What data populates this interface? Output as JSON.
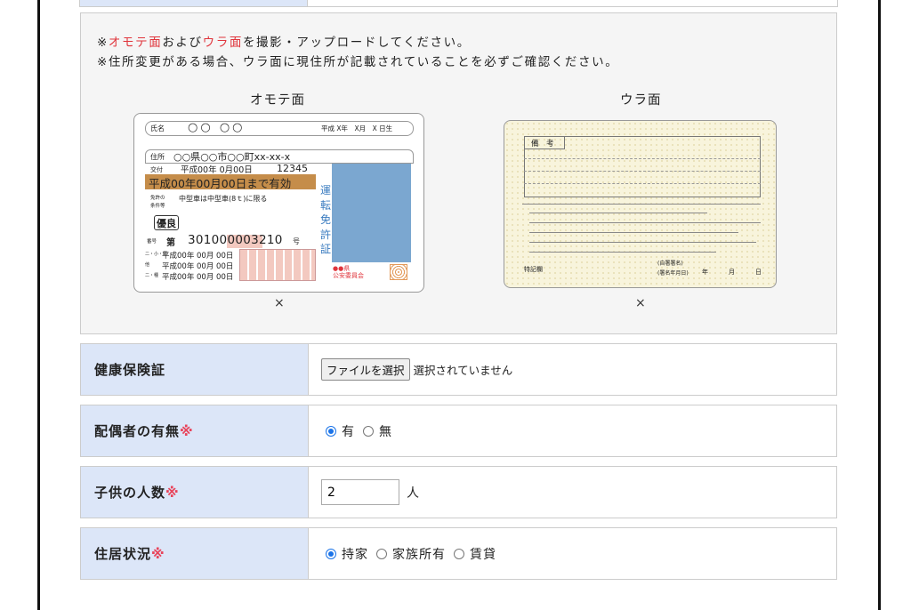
{
  "upload": {
    "note1_prefix": "※",
    "note1_front": "オモテ面",
    "note1_mid": "および",
    "note1_back": "ウラ面",
    "note1_suffix": "を撮影・アップロードしてください。",
    "note2": "※住所変更がある場合、ウラ面に現住所が記載されていることを必ずご確認ください。",
    "front_title": "オモテ面",
    "back_title": "ウラ面",
    "front_remove": "×",
    "back_remove": "×",
    "front_card": {
      "name_label": "氏名",
      "name_value": "○○ ○○",
      "birth": "平成 X年　X月　X 日生",
      "address_label": "住所",
      "address_value": "○○県○○市○○町xx-xx-x",
      "issue_label": "交付",
      "issue_value": "平成00年 0月00日",
      "issue_number": "12345",
      "expiry": "平成00年00月00日まで有効",
      "condition_label1": "免許の",
      "condition_label2": "条件等",
      "condition_value": "中型車は中型車(8ｔ)に限る",
      "excellent": "優良",
      "number_label": "番号",
      "number_prefix": "第",
      "number_value": "301000003210",
      "number_suffix": "号",
      "date_rows": [
        "平成00年 00月 00日",
        "平成00年 00月 00日",
        "平成00年 00月 00日"
      ],
      "date_labels": [
        "二・小・原",
        "他",
        "二・種"
      ],
      "vertical_title": "運転免許証",
      "commission": "●●県\n公安委員会"
    },
    "back_card": {
      "remarks_label": "備　考",
      "special_label": "特記欄",
      "signature_line1": "(自署署名)",
      "signature_line2": "(署名年月日)",
      "year": "年",
      "month": "月",
      "day": "日"
    }
  },
  "rows": [
    {
      "label": "健康保険証",
      "required": "",
      "file_button": "ファイルを選択",
      "file_status": "選択されていません"
    },
    {
      "label": "配偶者の有無",
      "required": "※",
      "options": [
        "有",
        "無"
      ],
      "selected": "有"
    },
    {
      "label": "子供の人数",
      "required": "※",
      "value": "2",
      "unit": "人"
    },
    {
      "label": "住居状況",
      "required": "※",
      "options": [
        "持家",
        "家族所有",
        "賃貸"
      ],
      "selected": "持家"
    }
  ],
  "colors": {
    "label_bg": "#dce6f8",
    "required": "#e8435a",
    "note_red": "#e0353c",
    "photo": "#7ba7d0",
    "expiry_band": "#c58d4a"
  }
}
